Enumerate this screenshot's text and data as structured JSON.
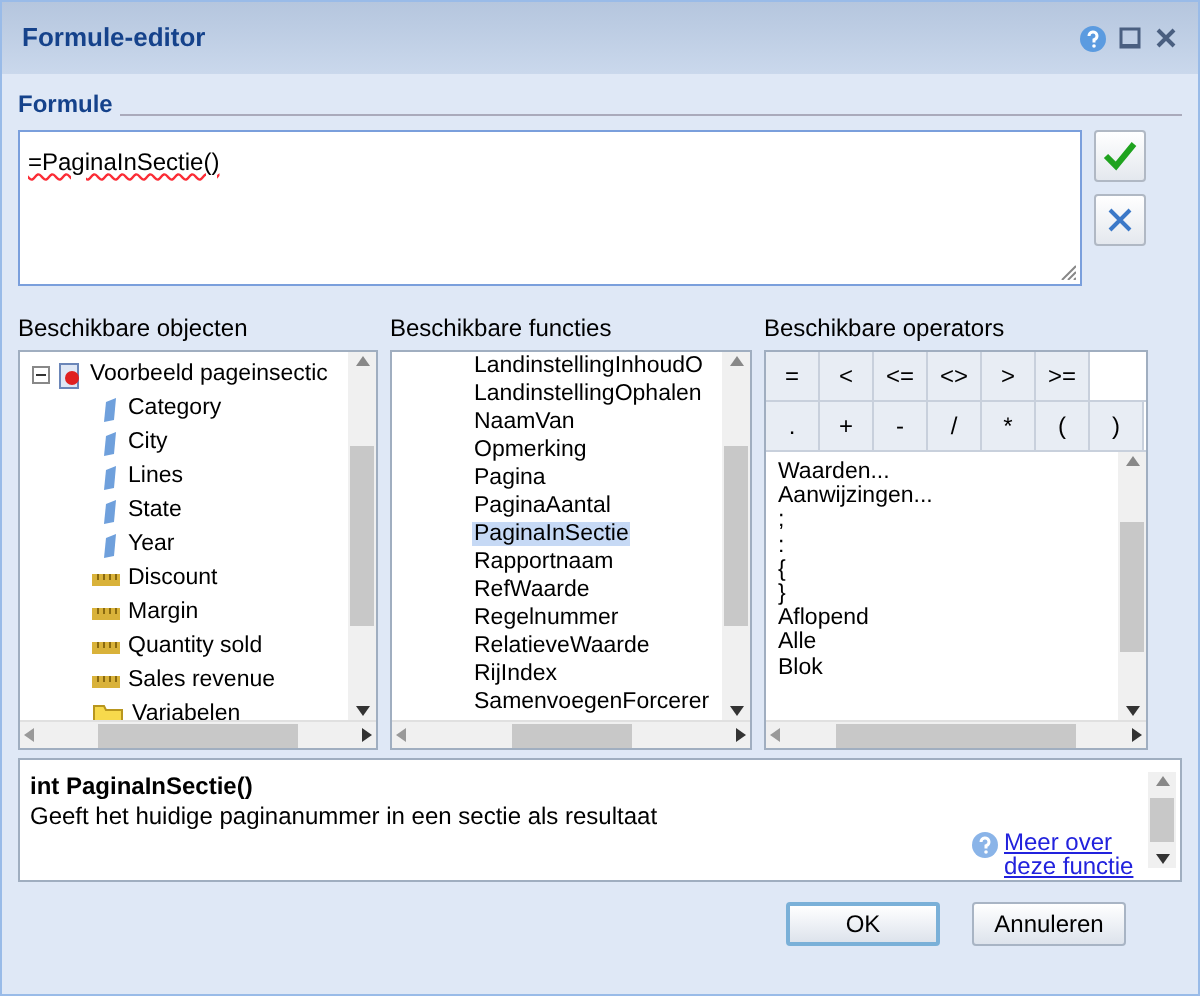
{
  "window": {
    "title": "Formule-editor"
  },
  "formula": {
    "label": "Formule",
    "value": "=PaginaInSectie()"
  },
  "objects": {
    "label": "Beschikbare objecten",
    "tree": [
      {
        "label": "Voorbeeld pageinsectic",
        "kind": "document",
        "expanded": true,
        "children": [
          {
            "label": "Category",
            "kind": "dimension"
          },
          {
            "label": "City",
            "kind": "dimension"
          },
          {
            "label": "Lines",
            "kind": "dimension"
          },
          {
            "label": "State",
            "kind": "dimension"
          },
          {
            "label": "Year",
            "kind": "dimension"
          },
          {
            "label": "Discount",
            "kind": "measure"
          },
          {
            "label": "Margin",
            "kind": "measure"
          },
          {
            "label": "Quantity sold",
            "kind": "measure"
          },
          {
            "label": "Sales revenue",
            "kind": "measure"
          },
          {
            "label": "Variabelen",
            "kind": "folder"
          }
        ]
      }
    ]
  },
  "functions": {
    "label": "Beschikbare functies",
    "items": [
      {
        "label": "LandinstellingInhoudO",
        "selected": false
      },
      {
        "label": "LandinstellingOphalen",
        "selected": false
      },
      {
        "label": "NaamVan",
        "selected": false
      },
      {
        "label": "Opmerking",
        "selected": false
      },
      {
        "label": "Pagina",
        "selected": false
      },
      {
        "label": "PaginaAantal",
        "selected": false
      },
      {
        "label": "PaginaInSectie",
        "selected": true
      },
      {
        "label": "Rapportnaam",
        "selected": false
      },
      {
        "label": "RefWaarde",
        "selected": false
      },
      {
        "label": "Regelnummer",
        "selected": false
      },
      {
        "label": "RelatieveWaarde",
        "selected": false
      },
      {
        "label": "RijIndex",
        "selected": false
      },
      {
        "label": "SamenvoegenForcerer",
        "selected": false
      }
    ]
  },
  "operators": {
    "label": "Beschikbare operators",
    "buttons": [
      [
        "=",
        "<",
        "<=",
        "<>",
        ">",
        ">="
      ],
      [
        ".",
        "+",
        "-",
        "/",
        "*",
        "(",
        ")"
      ]
    ],
    "items": [
      "Waarden...",
      "Aanwijzingen...",
      ";",
      ":",
      "{",
      "}",
      "Aflopend",
      "Alle",
      "Blok"
    ]
  },
  "description": {
    "signature": "int PaginaInSectie()",
    "text": "Geeft het huidige paginanummer in een sectie als resultaat",
    "link": "Meer over deze functie"
  },
  "buttons": [
    {
      "label": "OK",
      "default": true
    },
    {
      "label": "Annuleren",
      "default": false
    }
  ]
}
